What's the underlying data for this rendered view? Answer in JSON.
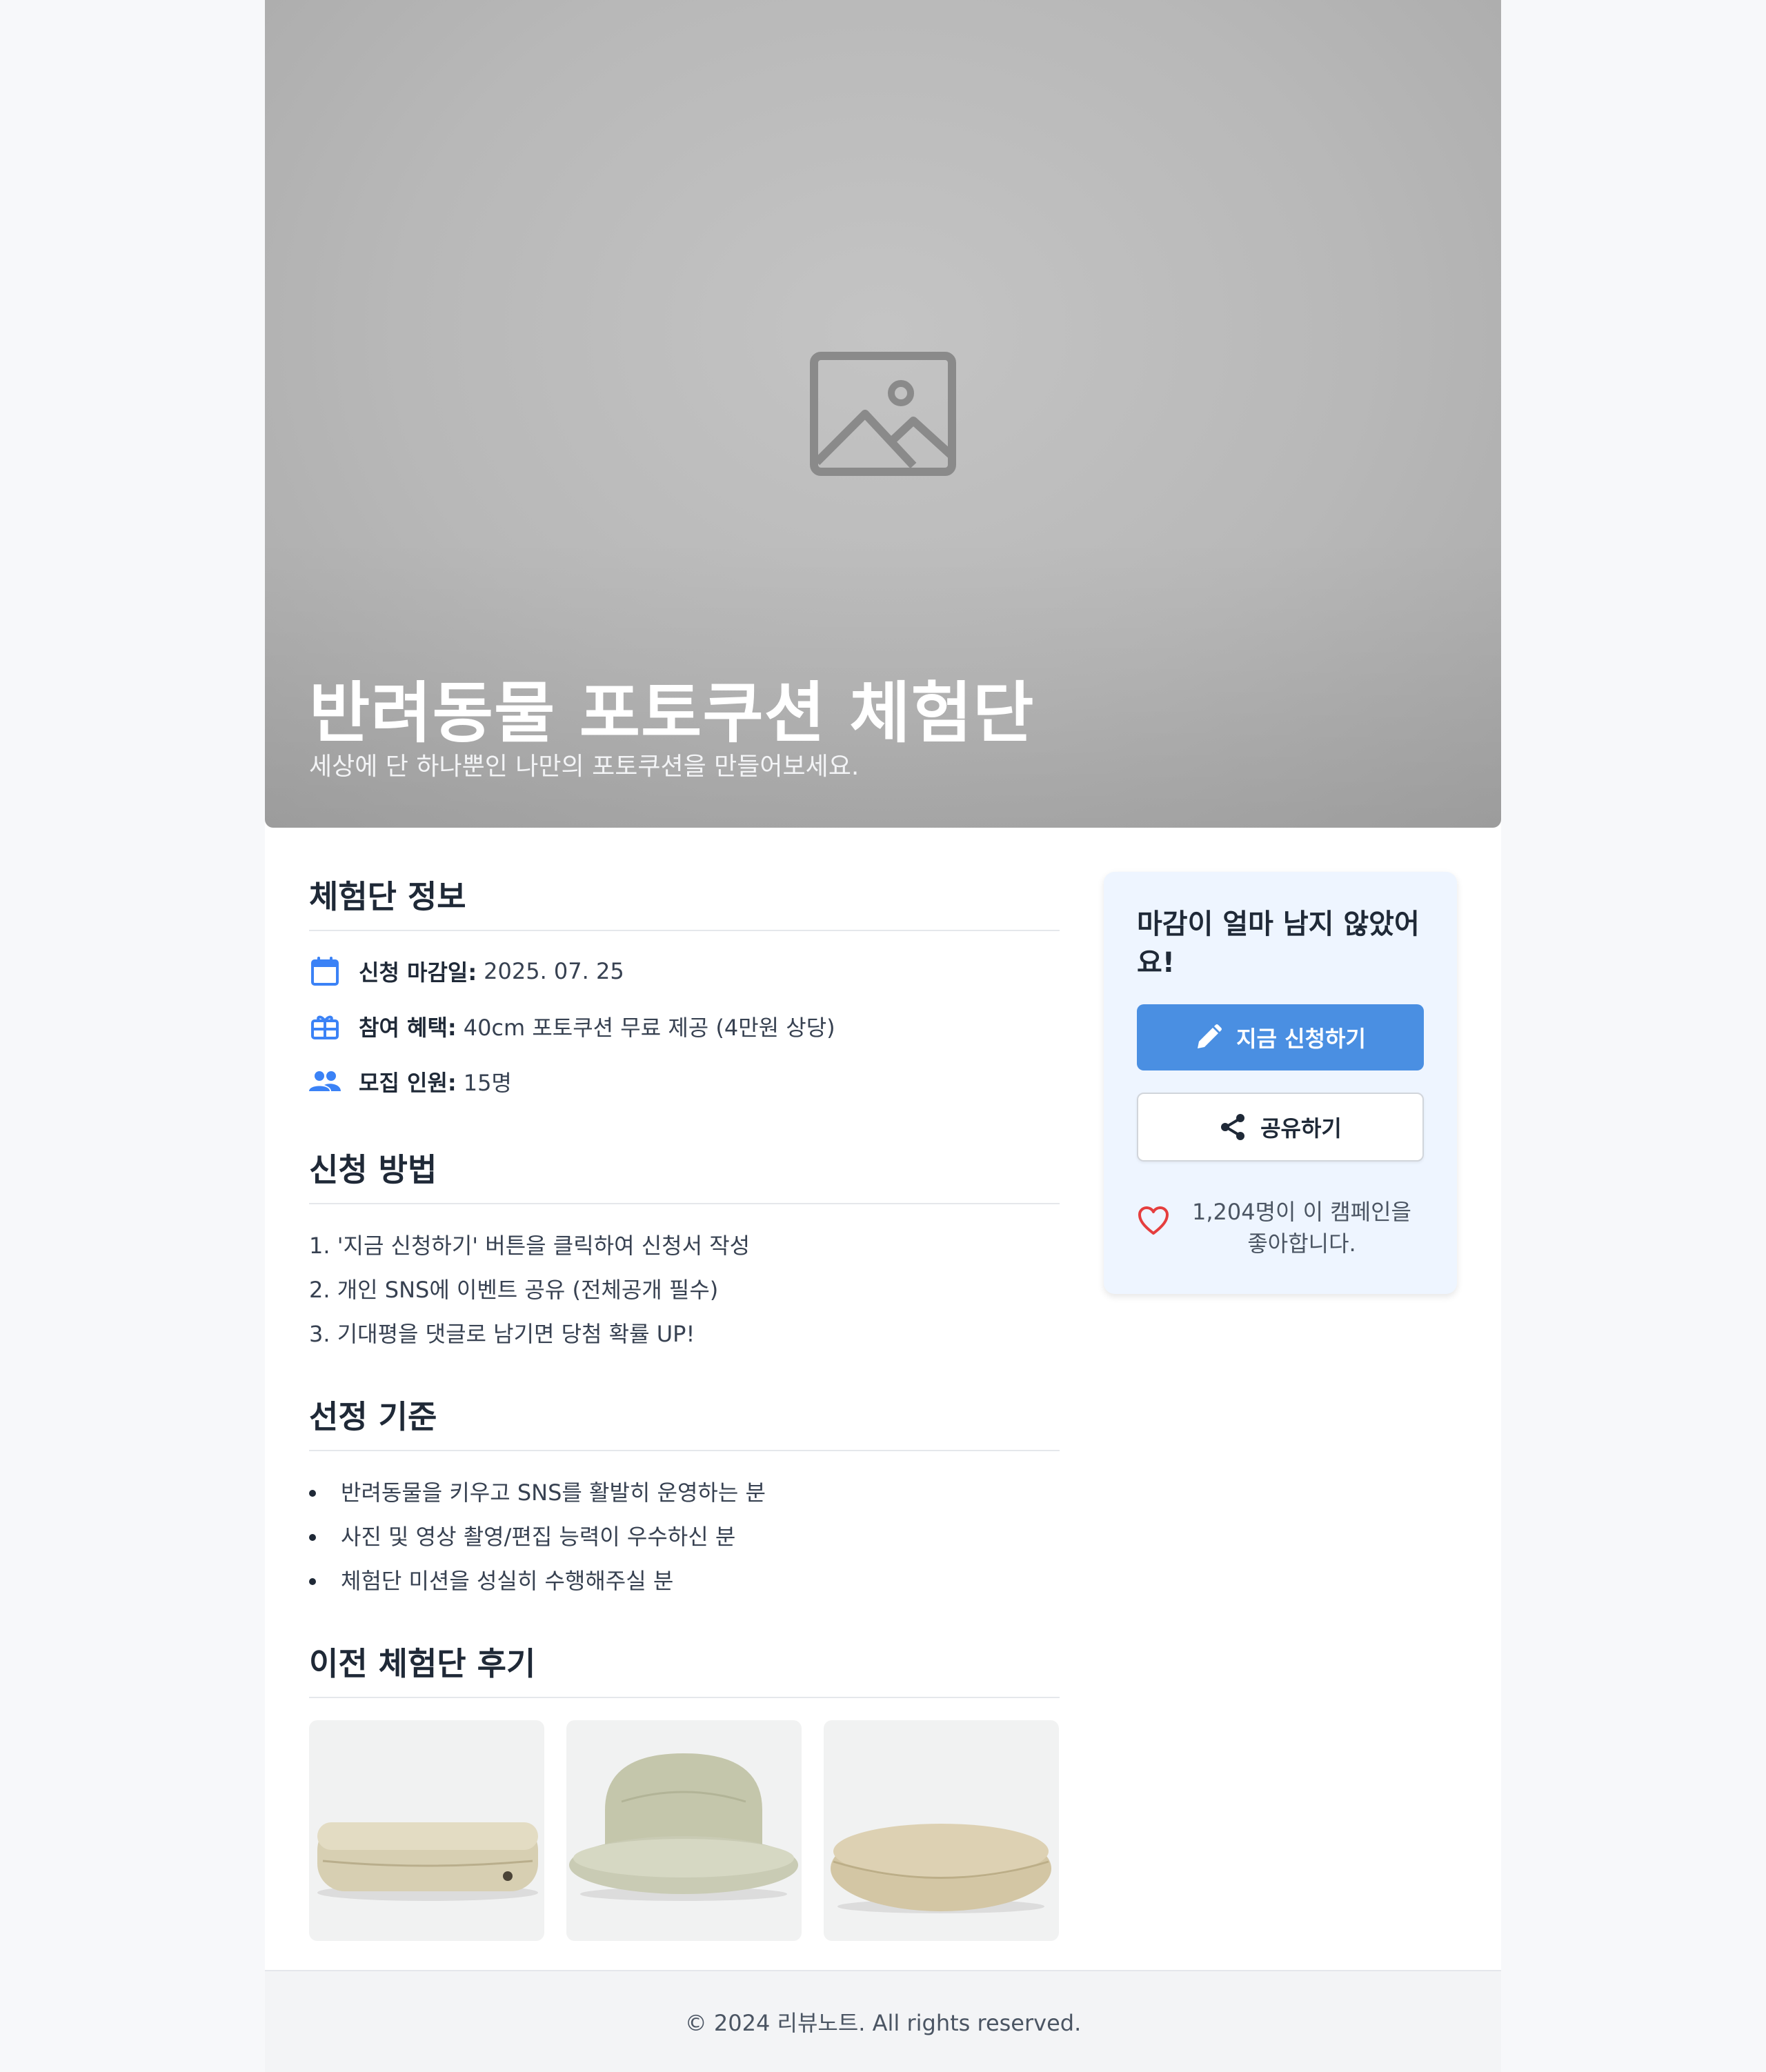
{
  "hero": {
    "image_icon": "image-placeholder-icon",
    "title": "반려동물 포토쿠션 체험단",
    "subtitle": "세상에 단 하나뿐인 나만의 포토쿠션을 만들어보세요."
  },
  "info": {
    "title": "체험단 정보",
    "items": [
      {
        "icon": "calendar-icon",
        "label": "신청 마감일:",
        "value": "2025. 07. 25"
      },
      {
        "icon": "gift-icon",
        "label": "참여 혜택:",
        "value": "40cm 포토쿠션 무료 제공 (4만원 상당)"
      },
      {
        "icon": "people-icon",
        "label": "모집 인원:",
        "value": "15명"
      }
    ]
  },
  "how": {
    "title": "신청 방법",
    "steps": [
      "1. '지금 신청하기' 버튼을 클릭하여 신청서 작성",
      "2. 개인 SNS에 이벤트 공유 (전체공개 필수)",
      "3. 기대평을 댓글로 남기면 당첨 확률 UP!"
    ]
  },
  "criteria": {
    "title": "선정 기준",
    "items": [
      "반려동물을 키우고 SNS를 활발히 운영하는 분",
      "사진 및 영상 촬영/편집 능력이 우수하신 분",
      "체험단 미션을 성실히 수행해주실 분"
    ]
  },
  "reviews": {
    "title": "이전 체험단 후기"
  },
  "sidebar": {
    "title": "마감이 얼마 남지 않았어요!",
    "apply_label": "지금 신청하기",
    "share_label": "공유하기",
    "likes_text": "1,204명이 이 캠페인을 좋아합니다.",
    "accent": "#4a8fe2",
    "heart_color": "#e53e3e"
  },
  "footer": {
    "copyright": "© 2024 리뷰노트. All rights reserved."
  }
}
